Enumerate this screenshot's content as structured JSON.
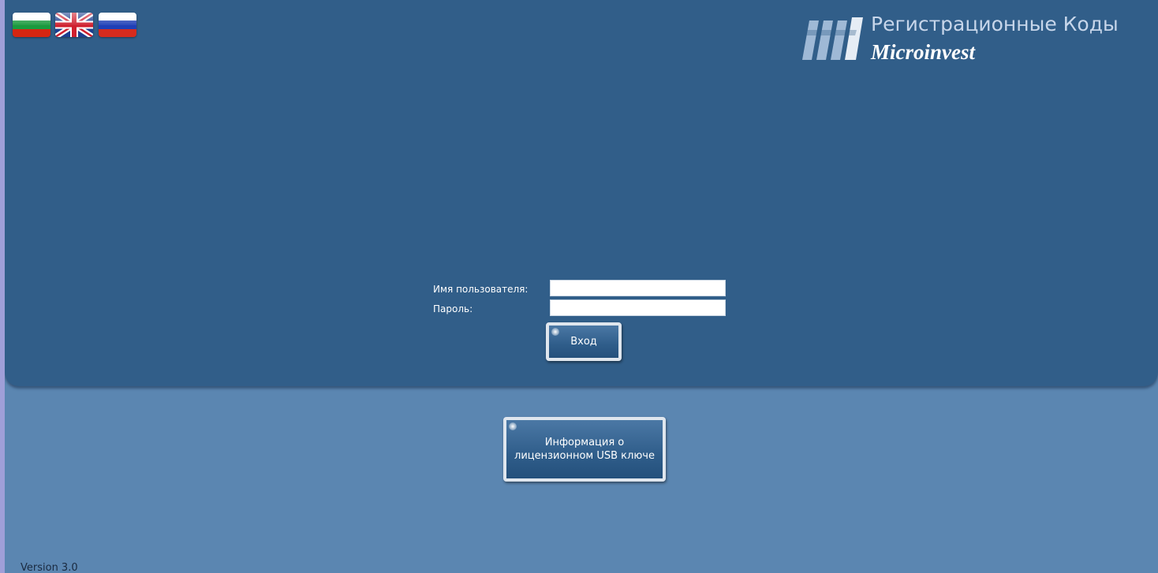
{
  "header": {
    "app_title": "Регистрационные Коды",
    "brand": "Microinvest",
    "languages": [
      {
        "code": "bg",
        "icon": "bulgarian-flag-icon"
      },
      {
        "code": "en",
        "icon": "uk-flag-icon"
      },
      {
        "code": "ru",
        "icon": "russian-flag-icon"
      }
    ]
  },
  "login": {
    "username_label": "Имя пользователя:",
    "username_value": "",
    "password_label": "Пароль:",
    "password_value": "",
    "submit_label": "Вход"
  },
  "usb_button_label_line1": "Информация о",
  "usb_button_label_line2": "лицензионном USB ключе",
  "footer": {
    "version": "Version 3.0"
  },
  "colors": {
    "top_panel": "#315e89",
    "bottom_panel": "#5b86b1",
    "page_border": "#9f9fd8",
    "button_border": "#dfe6ee",
    "title_text": "#c7d6ea"
  }
}
